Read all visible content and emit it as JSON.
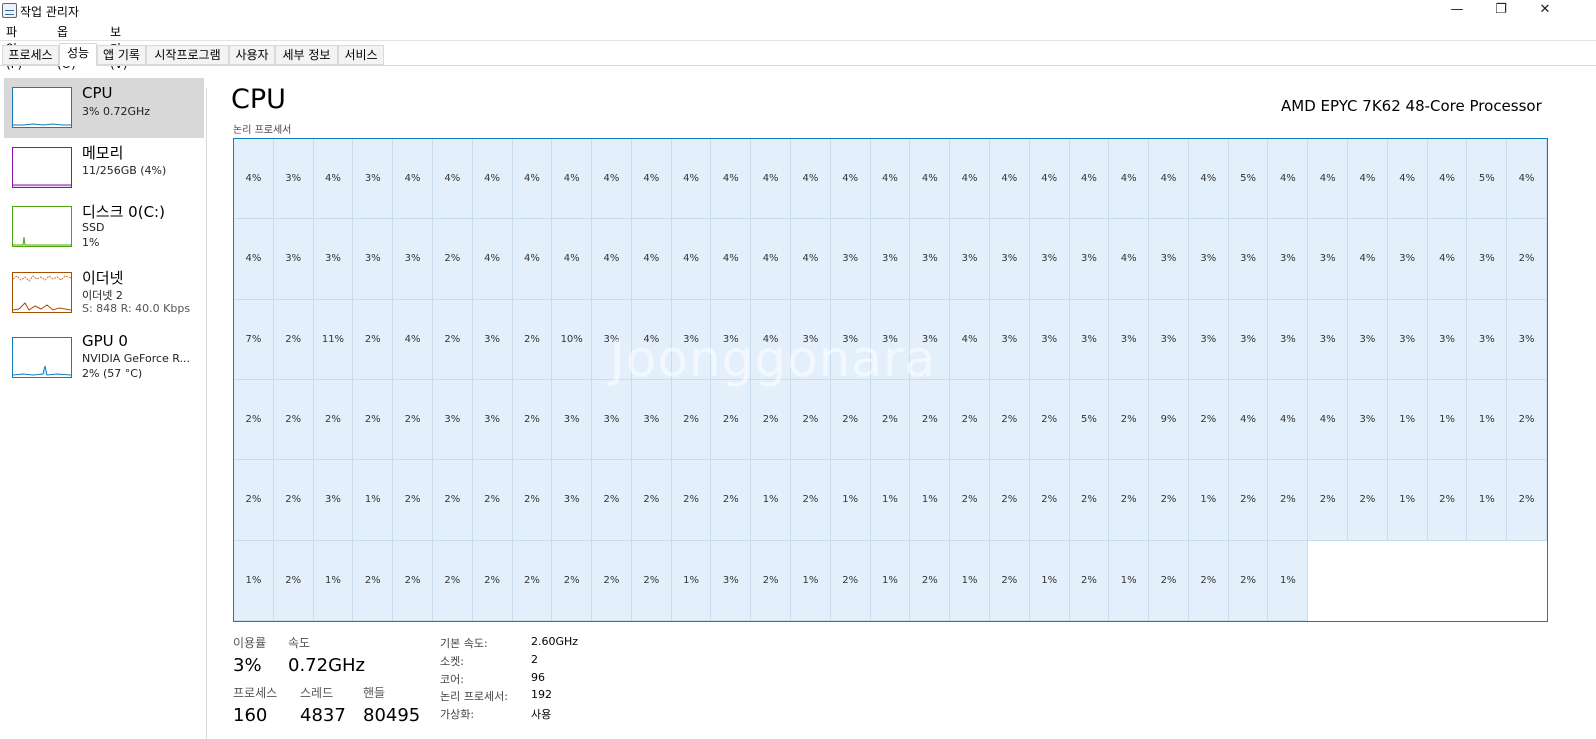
{
  "window": {
    "title": "작업 관리자",
    "minimize_icon": "—",
    "restore_icon": "❐",
    "close_icon": "✕"
  },
  "menu": [
    "파일(F)",
    "옵션(O)",
    "보기(V)"
  ],
  "tabs": [
    "프로세스",
    "성능",
    "앱 기록",
    "시작프로그램",
    "사용자",
    "세부 정보",
    "서비스"
  ],
  "active_tab": "성능",
  "sidebar": {
    "items": [
      {
        "name": "CPU",
        "lines": [
          "3% 0.72GHz"
        ],
        "color": "#117dbb"
      },
      {
        "name": "메모리",
        "lines": [
          "11/256GB (4%)"
        ],
        "color": "#8b12ae"
      },
      {
        "name": "디스크 0(C:)",
        "lines": [
          "SSD",
          "1%"
        ],
        "color": "#4da60c"
      },
      {
        "name": "이더넷",
        "lines": [
          "이더넷 2",
          "S: 848  R: 40.0 Kbps"
        ],
        "color": "#a74f01"
      },
      {
        "name": "GPU 0",
        "lines": [
          "NVIDIA GeForce R...",
          "2% (57 °C)"
        ],
        "color": "#117dbb"
      }
    ]
  },
  "main": {
    "title": "CPU",
    "processor": "AMD EPYC 7K62 48-Core Processor",
    "graph_caption": "논리 프로세서",
    "watermark": "Joonggonara",
    "core_usage": [
      [
        "4%",
        "3%",
        "4%",
        "3%",
        "4%",
        "4%",
        "4%",
        "4%",
        "4%",
        "4%",
        "4%",
        "4%",
        "4%",
        "4%",
        "4%",
        "4%",
        "4%",
        "4%",
        "4%",
        "4%",
        "4%",
        "4%",
        "4%",
        "4%",
        "4%",
        "5%",
        "4%",
        "4%",
        "4%",
        "4%",
        "4%",
        "5%",
        "4%"
      ],
      [
        "4%",
        "3%",
        "3%",
        "3%",
        "3%",
        "2%",
        "4%",
        "4%",
        "4%",
        "4%",
        "4%",
        "4%",
        "4%",
        "4%",
        "4%",
        "3%",
        "3%",
        "3%",
        "3%",
        "3%",
        "3%",
        "3%",
        "4%",
        "3%",
        "3%",
        "3%",
        "3%",
        "3%",
        "4%",
        "3%",
        "4%",
        "3%",
        "2%"
      ],
      [
        "7%",
        "2%",
        "11%",
        "2%",
        "4%",
        "2%",
        "3%",
        "2%",
        "10%",
        "3%",
        "4%",
        "3%",
        "3%",
        "4%",
        "3%",
        "3%",
        "3%",
        "3%",
        "4%",
        "3%",
        "3%",
        "3%",
        "3%",
        "3%",
        "3%",
        "3%",
        "3%",
        "3%",
        "3%",
        "3%",
        "3%",
        "3%",
        "3%"
      ],
      [
        "2%",
        "2%",
        "2%",
        "2%",
        "2%",
        "3%",
        "3%",
        "2%",
        "3%",
        "3%",
        "3%",
        "2%",
        "2%",
        "2%",
        "2%",
        "2%",
        "2%",
        "2%",
        "2%",
        "2%",
        "2%",
        "5%",
        "2%",
        "9%",
        "2%",
        "4%",
        "4%",
        "4%",
        "3%",
        "1%",
        "1%",
        "1%",
        "2%"
      ],
      [
        "2%",
        "2%",
        "3%",
        "1%",
        "2%",
        "2%",
        "2%",
        "2%",
        "3%",
        "2%",
        "2%",
        "2%",
        "2%",
        "1%",
        "2%",
        "1%",
        "1%",
        "1%",
        "2%",
        "2%",
        "2%",
        "2%",
        "2%",
        "2%",
        "1%",
        "2%",
        "2%",
        "2%",
        "2%",
        "1%",
        "2%",
        "1%",
        "2%"
      ],
      [
        "1%",
        "2%",
        "1%",
        "2%",
        "2%",
        "2%",
        "2%",
        "2%",
        "2%",
        "2%",
        "2%",
        "1%",
        "3%",
        "2%",
        "1%",
        "2%",
        "1%",
        "2%",
        "1%",
        "2%",
        "1%",
        "2%",
        "1%",
        "2%",
        "2%",
        "2%",
        "1%"
      ]
    ]
  },
  "stats": {
    "utilization_label": "이용률",
    "utilization": "3%",
    "speed_label": "속도",
    "speed": "0.72GHz",
    "processes_label": "프로세스",
    "processes": "160",
    "threads_label": "스레드",
    "threads": "4837",
    "handles_label": "핸들",
    "handles": "80495"
  },
  "details": [
    {
      "label": "기본 속도:",
      "value": "2.60GHz"
    },
    {
      "label": "소켓:",
      "value": "2"
    },
    {
      "label": "코어:",
      "value": "96"
    },
    {
      "label": "논리 프로세서:",
      "value": "192"
    },
    {
      "label": "가상화:",
      "value": "사용"
    }
  ]
}
